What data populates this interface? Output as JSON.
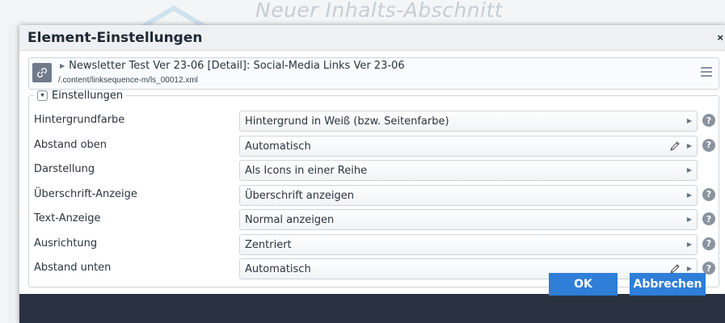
{
  "background": {
    "page_heading": "Neuer Inhalts-Abschnitt"
  },
  "dialog": {
    "title": "Element-Einstellungen",
    "close_glyph": "×"
  },
  "resource": {
    "title": "Newsletter Test Ver 23-06 [Detail]: Social-Media Links Ver 23-06",
    "path": "/.content/linksequence-m/ls_00012.xml",
    "icon": "link-icon"
  },
  "fieldset": {
    "legend": "Einstellungen",
    "rows": [
      {
        "label": "Hintergrundfarbe",
        "value": "Hintergrund in Weiß (bzw. Seitenfarbe)",
        "pencil": false,
        "help": true
      },
      {
        "label": "Abstand oben",
        "value": "Automatisch",
        "pencil": true,
        "help": true
      },
      {
        "label": "Darstellung",
        "value": "Als Icons in einer Reihe",
        "pencil": false,
        "help": false
      },
      {
        "label": "Überschrift-Anzeige",
        "value": "Überschrift anzeigen",
        "pencil": false,
        "help": true
      },
      {
        "label": "Text-Anzeige",
        "value": "Normal anzeigen",
        "pencil": false,
        "help": true
      },
      {
        "label": "Ausrichtung",
        "value": "Zentriert",
        "pencil": false,
        "help": true
      },
      {
        "label": "Abstand unten",
        "value": "Automatisch",
        "pencil": true,
        "help": true
      }
    ]
  },
  "footer": {
    "ok_label": "OK",
    "cancel_label": "Abbrechen"
  },
  "colors": {
    "accent": "#2f7ed8",
    "footer_bg": "#2a3241",
    "help_icon": "#8a939e"
  }
}
